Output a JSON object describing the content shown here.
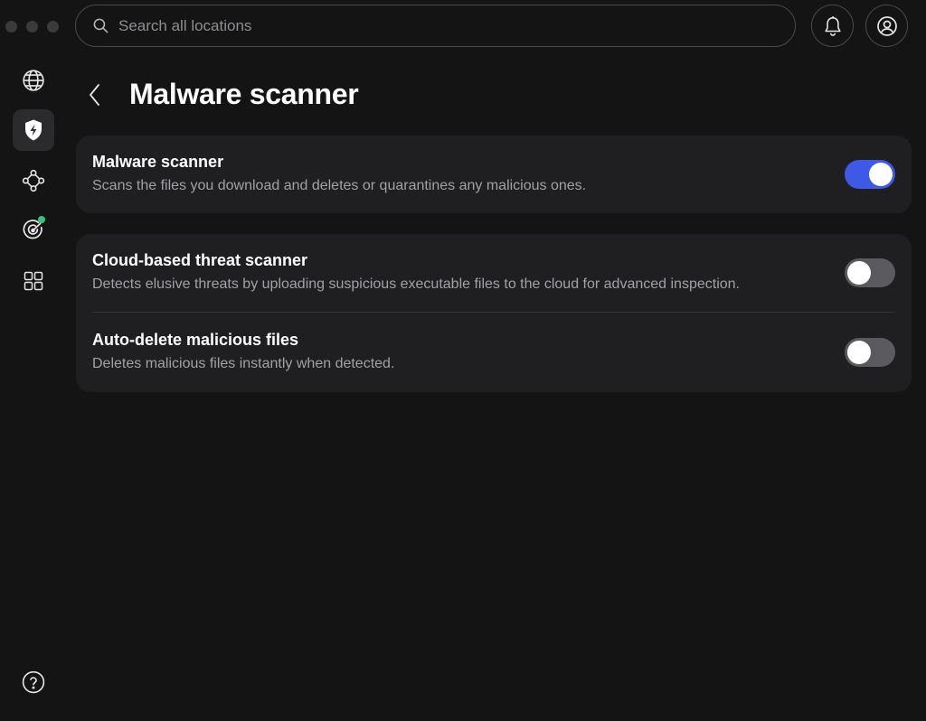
{
  "search": {
    "placeholder": "Search all locations",
    "value": ""
  },
  "sidebar": {
    "items": [
      {
        "icon": "globe-icon",
        "active": false
      },
      {
        "icon": "shield-bolt-icon",
        "active": true
      },
      {
        "icon": "network-nodes-icon",
        "active": false
      },
      {
        "icon": "dark-web-radar-icon",
        "active": false,
        "badge_color": "#35c47a"
      },
      {
        "icon": "apps-grid-icon",
        "active": false
      }
    ],
    "help_icon": "help-icon"
  },
  "header": {
    "title": "Malware scanner"
  },
  "settings": [
    {
      "title": "Malware scanner",
      "description": "Scans the files you download and deletes or quarantines any malicious ones.",
      "enabled": true
    },
    {
      "title": "Cloud-based threat scanner",
      "description": "Detects elusive threats by uploading suspicious executable files to the cloud for advanced inspection.",
      "enabled": false
    },
    {
      "title": "Auto-delete malicious files",
      "description": "Deletes malicious files instantly when detected.",
      "enabled": false
    }
  ],
  "colors": {
    "accent": "#3d59e6",
    "background": "#141415",
    "card": "#1f1f22",
    "status_green": "#35c47a"
  }
}
